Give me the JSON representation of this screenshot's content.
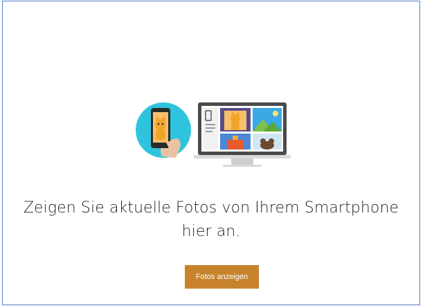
{
  "promo": {
    "message_line1": "Zeigen Sie aktuelle Fotos von Ihrem Smartphone",
    "message_line2": "hier an.",
    "button_label": "Fotos anzeigen"
  },
  "illustration": {
    "icon": "phone-to-pc-photos-illustration",
    "colors": {
      "circle": "#2ec4dd",
      "cat": "#f0a52a",
      "laptop": "#4a4a4a",
      "screen": "#ffffff",
      "tile_blue": "#3aa9e6",
      "tile_green": "#7cc14a"
    }
  },
  "theme": {
    "border": "#4f7fc8",
    "button_bg": "#c8842c"
  }
}
